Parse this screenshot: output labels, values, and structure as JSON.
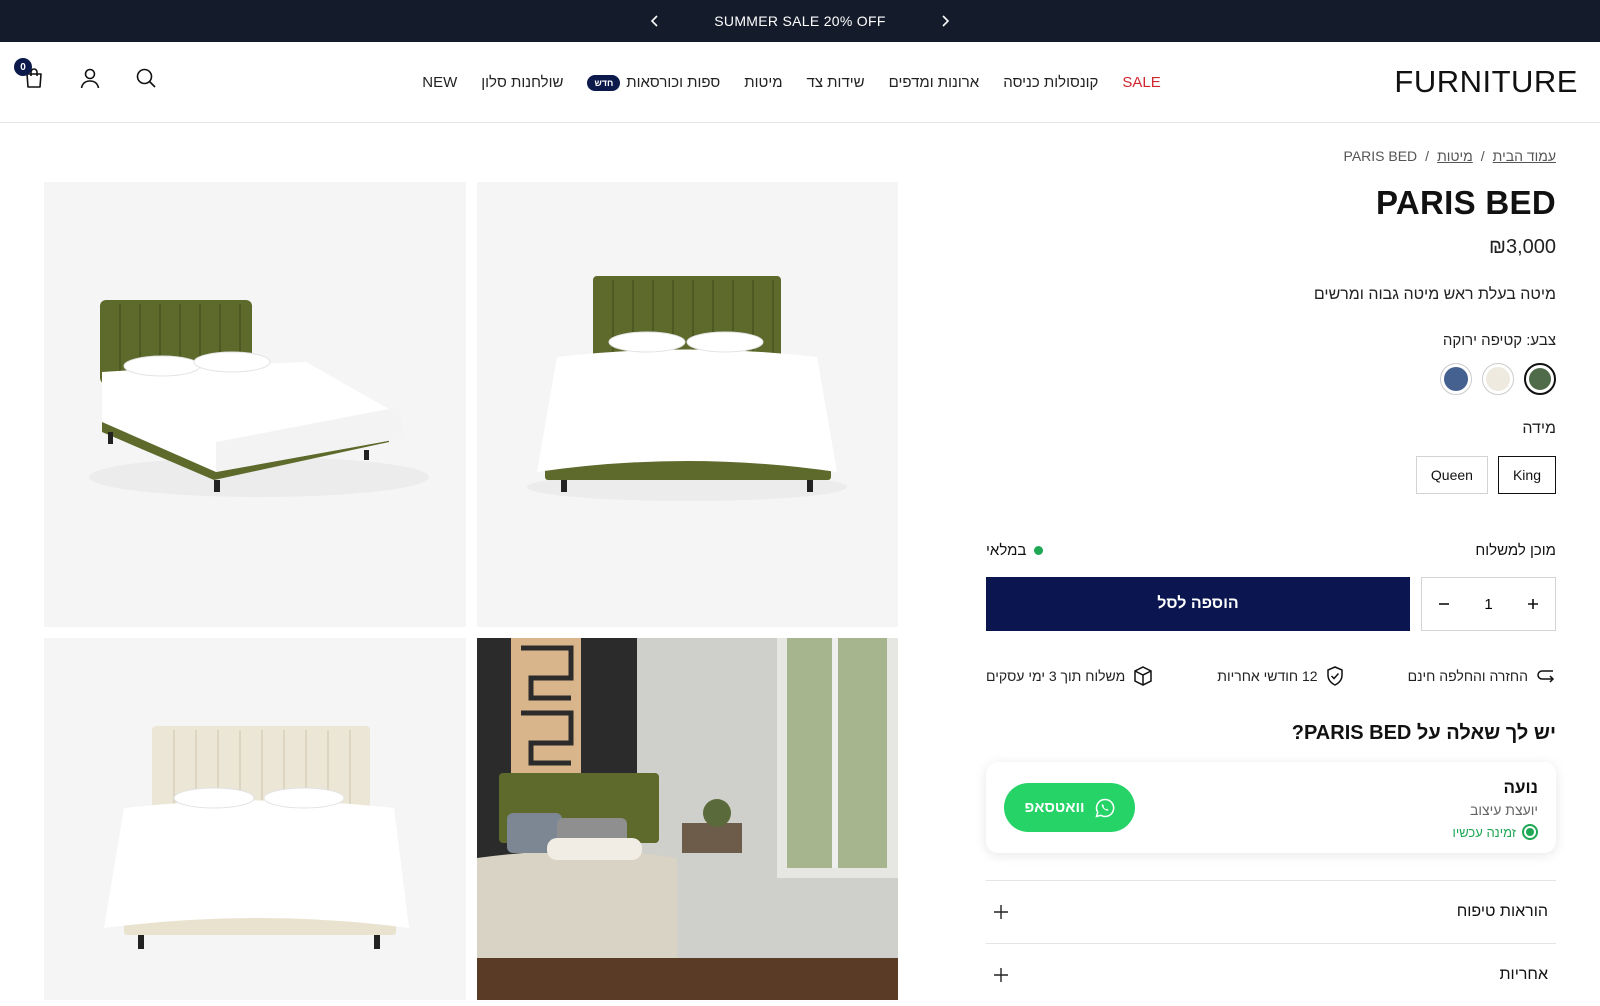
{
  "announcement": {
    "text": "SUMMER SALE 20% OFF"
  },
  "header": {
    "logo": "FURNITURE",
    "cart_count": "0",
    "nav": [
      {
        "label": "NEW"
      },
      {
        "label": "שולחנות סלון"
      },
      {
        "label": "ספות וכורסאות",
        "badge": "חדש"
      },
      {
        "label": "מיטות"
      },
      {
        "label": "שידות צד"
      },
      {
        "label": "ארונות ומדפים"
      },
      {
        "label": "קונסולות כניסה"
      },
      {
        "label": "SALE"
      }
    ]
  },
  "breadcrumb": {
    "home": "עמוד הבית",
    "category": "מיטות",
    "current": "PARIS BED",
    "sep": "/"
  },
  "product": {
    "title": "PARIS BED",
    "price": "₪3,000",
    "description": "מיטה בעלת ראש מיטה גבוה ומרשים",
    "color_label": "צבע: קטיפה ירוקה",
    "colors": [
      {
        "name": "קטיפה ירוקה",
        "hex": "#4f6b4a",
        "selected": true
      },
      {
        "name": "שמנת",
        "hex": "#eeeae0",
        "selected": false
      },
      {
        "name": "כחול",
        "hex": "#44618f",
        "selected": false
      }
    ],
    "size_label": "מידה",
    "sizes": [
      {
        "label": "King",
        "selected": true
      },
      {
        "label": "Queen",
        "selected": false
      }
    ],
    "shipping_label": "מוכן למשלוח",
    "stock_label": "במלאי",
    "quantity": "1",
    "add_to_cart": "הוספה לסל"
  },
  "perks": [
    {
      "icon": "return-icon",
      "label": "החזרה והחלפה חינם"
    },
    {
      "icon": "shield-check-icon",
      "label": "12 חודשי אחריות"
    },
    {
      "icon": "box-icon",
      "label": "משלוח תוך 3 ימי עסקים"
    }
  ],
  "question": {
    "title": "יש לך שאלה על PARIS BED?",
    "advisor_name": "נועה",
    "advisor_role": "יועצת עיצוב",
    "advisor_status": "זמינה עכשיו",
    "whatsapp_label": "וואטסאפ"
  },
  "accordion": [
    {
      "label": "הוראות טיפוח"
    },
    {
      "label": "אחריות"
    }
  ]
}
